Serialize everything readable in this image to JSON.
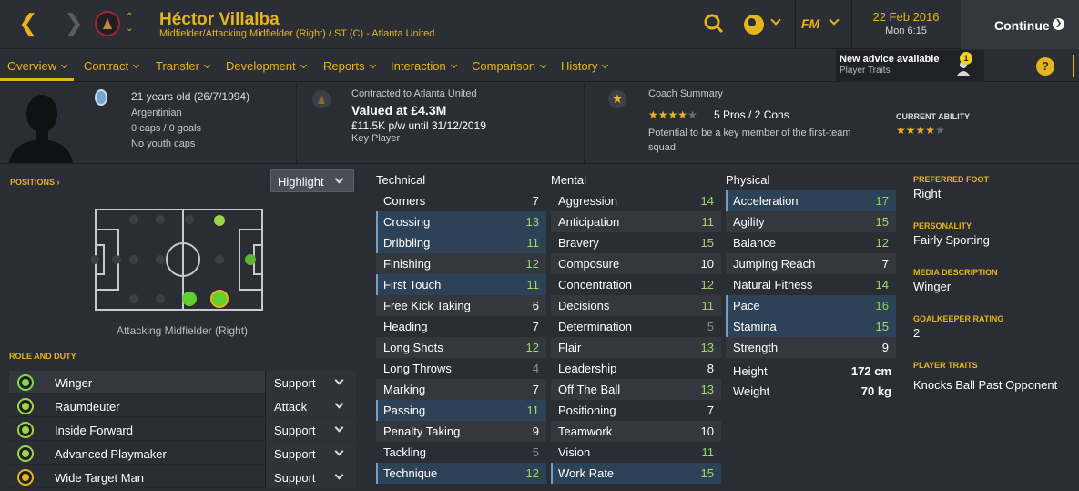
{
  "header": {
    "player_name": "Héctor Villalba",
    "player_subtitle": "Midfielder/Attacking Midfielder (Right) / ST (C) - Atlanta United",
    "date": "22 Feb 2016",
    "time": "Mon 6:15",
    "continue_label": "Continue",
    "fm_logo": "FM"
  },
  "tabs": [
    "Overview",
    "Contract",
    "Transfer",
    "Development",
    "Reports",
    "Interaction",
    "Comparison",
    "History"
  ],
  "advice": {
    "title": "New advice available",
    "subtitle": "Player Traits",
    "count": "1"
  },
  "help_label": "?",
  "info": {
    "age": "21 years old (26/7/1994)",
    "nationality": "Argentinian",
    "caps": "0 caps / 0 goals",
    "youth_caps": "No youth caps",
    "contracted": "Contracted to Atlanta United",
    "valued": "Valued at £4.3M",
    "wage": "£11.5K p/w until 31/12/2019",
    "status": "Key Player",
    "coach_title": "Coach Summary",
    "coach_stars": 4,
    "coach_pros_cons": "5 Pros / 2 Cons",
    "coach_text": "Potential to be a key member of the first-team squad.",
    "current_ability_label": "CURRENT ABILITY",
    "current_ability_stars": 4
  },
  "positions": {
    "label": "POSITIONS",
    "highlight_label": "Highlight",
    "position_name": "Attacking Midfielder (Right)"
  },
  "roles": {
    "label": "ROLE AND DUTY",
    "items": [
      {
        "name": "Winger",
        "duty": "Support"
      },
      {
        "name": "Raumdeuter",
        "duty": "Attack"
      },
      {
        "name": "Inside Forward",
        "duty": "Support"
      },
      {
        "name": "Advanced Playmaker",
        "duty": "Support"
      },
      {
        "name": "Wide Target Man",
        "duty": "Support"
      }
    ]
  },
  "attributes": {
    "technical_title": "Technical",
    "mental_title": "Mental",
    "physical_title": "Physical",
    "technical": [
      {
        "name": "Corners",
        "value": "7"
      },
      {
        "name": "Crossing",
        "value": "13"
      },
      {
        "name": "Dribbling",
        "value": "11"
      },
      {
        "name": "Finishing",
        "value": "12"
      },
      {
        "name": "First Touch",
        "value": "11"
      },
      {
        "name": "Free Kick Taking",
        "value": "6"
      },
      {
        "name": "Heading",
        "value": "7"
      },
      {
        "name": "Long Shots",
        "value": "12"
      },
      {
        "name": "Long Throws",
        "value": "4"
      },
      {
        "name": "Marking",
        "value": "7"
      },
      {
        "name": "Passing",
        "value": "11"
      },
      {
        "name": "Penalty Taking",
        "value": "9"
      },
      {
        "name": "Tackling",
        "value": "5"
      },
      {
        "name": "Technique",
        "value": "12"
      }
    ],
    "mental": [
      {
        "name": "Aggression",
        "value": "14"
      },
      {
        "name": "Anticipation",
        "value": "11"
      },
      {
        "name": "Bravery",
        "value": "15"
      },
      {
        "name": "Composure",
        "value": "10"
      },
      {
        "name": "Concentration",
        "value": "12"
      },
      {
        "name": "Decisions",
        "value": "11"
      },
      {
        "name": "Determination",
        "value": "5"
      },
      {
        "name": "Flair",
        "value": "13"
      },
      {
        "name": "Leadership",
        "value": "8"
      },
      {
        "name": "Off The Ball",
        "value": "13"
      },
      {
        "name": "Positioning",
        "value": "7"
      },
      {
        "name": "Teamwork",
        "value": "10"
      },
      {
        "name": "Vision",
        "value": "11"
      },
      {
        "name": "Work Rate",
        "value": "15"
      }
    ],
    "physical": [
      {
        "name": "Acceleration",
        "value": "17"
      },
      {
        "name": "Agility",
        "value": "15"
      },
      {
        "name": "Balance",
        "value": "12"
      },
      {
        "name": "Jumping Reach",
        "value": "7"
      },
      {
        "name": "Natural Fitness",
        "value": "14"
      },
      {
        "name": "Pace",
        "value": "16"
      },
      {
        "name": "Stamina",
        "value": "15"
      },
      {
        "name": "Strength",
        "value": "9"
      }
    ],
    "height_label": "Height",
    "height": "172 cm",
    "weight_label": "Weight",
    "weight": "70 kg"
  },
  "side": {
    "preferred_foot_title": "PREFERRED FOOT",
    "preferred_foot": "Right",
    "personality_title": "PERSONALITY",
    "personality": "Fairly Sporting",
    "media_title": "MEDIA DESCRIPTION",
    "media": "Winger",
    "gk_title": "GOALKEEPER RATING",
    "gk": "2",
    "traits_title": "PLAYER TRAITS",
    "traits": "Knocks Ball Past Opponent"
  },
  "colors": {
    "accent": "#e8b41c",
    "highlight_row": "#2d4257",
    "green": "#7fd94a"
  }
}
